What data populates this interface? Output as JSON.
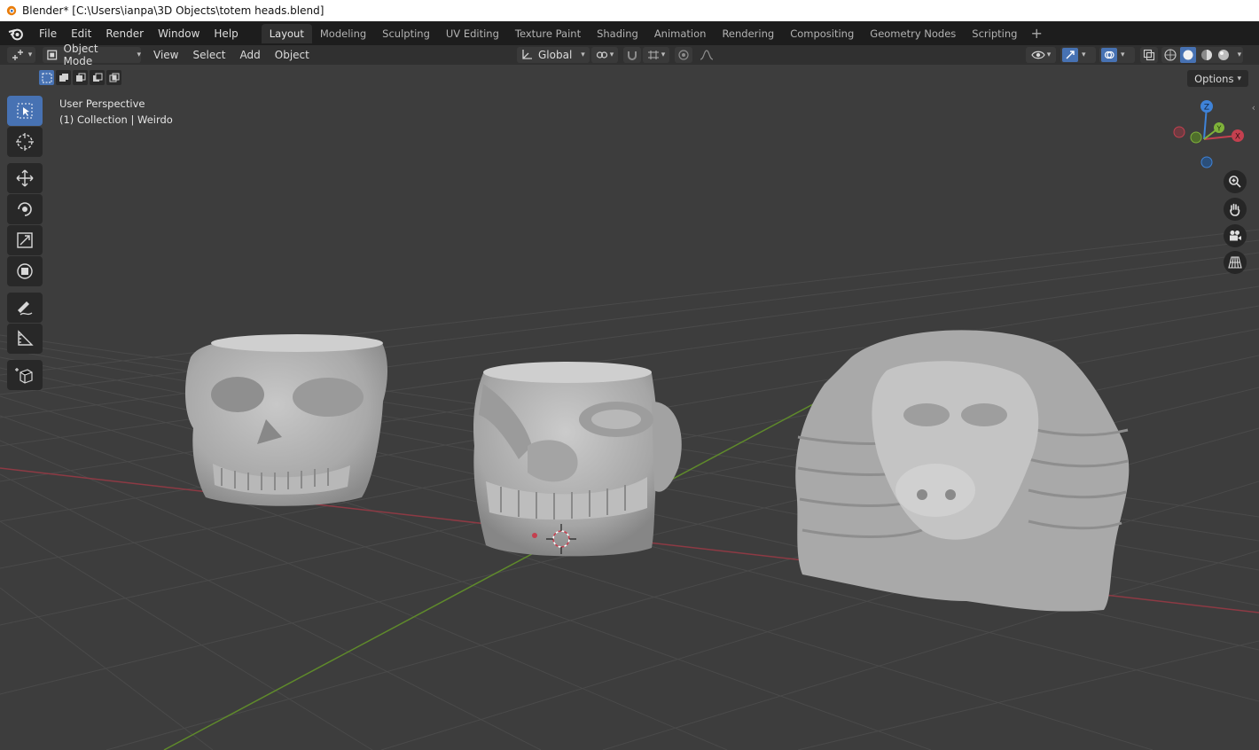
{
  "window": {
    "title": "Blender* [C:\\Users\\ianpa\\3D Objects\\totem heads.blend]"
  },
  "menu": {
    "items": [
      {
        "label": "File"
      },
      {
        "label": "Edit"
      },
      {
        "label": "Render"
      },
      {
        "label": "Window"
      },
      {
        "label": "Help"
      }
    ]
  },
  "workspaces": {
    "tabs": [
      {
        "label": "Layout",
        "active": true
      },
      {
        "label": "Modeling"
      },
      {
        "label": "Sculpting"
      },
      {
        "label": "UV Editing"
      },
      {
        "label": "Texture Paint"
      },
      {
        "label": "Shading"
      },
      {
        "label": "Animation"
      },
      {
        "label": "Rendering"
      },
      {
        "label": "Compositing"
      },
      {
        "label": "Geometry Nodes"
      },
      {
        "label": "Scripting"
      }
    ],
    "add_label": "+"
  },
  "header": {
    "mode_label": "Object Mode",
    "menus": [
      {
        "label": "View"
      },
      {
        "label": "Select"
      },
      {
        "label": "Add"
      },
      {
        "label": "Object"
      }
    ],
    "transform_orientation": "Global"
  },
  "viewport": {
    "perspective_label": "User Perspective",
    "collection_label": "(1) Collection | Weirdo",
    "options_label": "Options"
  },
  "gizmo": {
    "z_label": "Z",
    "y_label": "Y",
    "x_label": "X"
  },
  "colors": {
    "accent": "#4772b3",
    "axis_x": "#c4404f",
    "axis_y": "#7fb23a",
    "axis_z": "#3f83d8",
    "viewport_bg": "#3d3d3d"
  },
  "icons": {
    "left_toolbar": [
      "select-box-icon",
      "cursor-icon",
      "move-icon",
      "rotate-icon",
      "scale-icon",
      "transform-icon",
      "annotate-icon",
      "measure-icon",
      "add-cube-icon"
    ],
    "nav": [
      "zoom-icon",
      "hand-pan-icon",
      "camera-icon",
      "grid-perspective-icon"
    ]
  }
}
